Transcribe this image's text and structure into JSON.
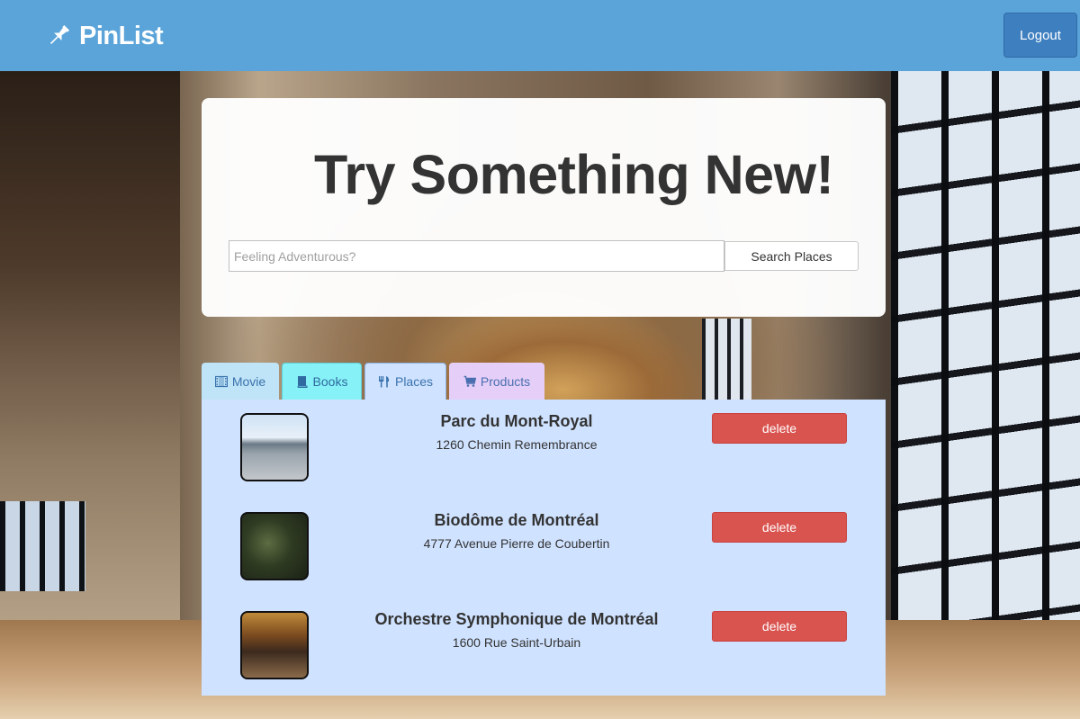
{
  "navbar": {
    "brand": "PinList",
    "brand_icon": "pushpin-icon",
    "logout_label": "Logout",
    "color": "#5ba4d9"
  },
  "hero": {
    "title": "Try Something New!",
    "search_placeholder": "Feeling Adventurous?",
    "search_value": "",
    "search_button_label": "Search Places"
  },
  "tabs": [
    {
      "label": "Movie",
      "icon": "film-icon",
      "color": "#bfe3f7"
    },
    {
      "label": "Books",
      "icon": "book-icon",
      "color": "#86f1f6"
    },
    {
      "label": "Places",
      "icon": "utensils-icon",
      "color": "#cfe2ff"
    },
    {
      "label": "Products",
      "icon": "cart-icon",
      "color": "#e5cff8"
    }
  ],
  "places": [
    {
      "name": "Parc du Mont-Royal",
      "address": "1260 Chemin Remembrance",
      "delete_label": "delete"
    },
    {
      "name": "Biodôme de Montréal",
      "address": "4777 Avenue Pierre de Coubertin",
      "delete_label": "delete"
    },
    {
      "name": "Orchestre Symphonique de Montréal",
      "address": "1600 Rue Saint-Urbain",
      "delete_label": "delete"
    }
  ],
  "colors": {
    "delete": "#d9534f",
    "panel": "#cfe2ff"
  }
}
